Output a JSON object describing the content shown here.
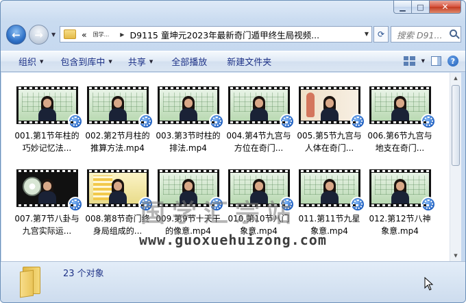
{
  "window": {
    "address_breadcrumbs": [
      "«",
      "国学...",
      "D9115 童坤元2023年最新奇门遁甲终生局视频..."
    ],
    "search_placeholder": "搜索 D91..."
  },
  "toolbar": {
    "organize": "组织",
    "include_library": "包含到库中",
    "share": "共享",
    "play_all": "全部播放",
    "new_folder": "新建文件夹"
  },
  "files": [
    {
      "name": "001.第1节年柱的巧妙记忆法...",
      "thumb": "board"
    },
    {
      "name": "002.第2节月柱的推算方法.mp4",
      "thumb": "board"
    },
    {
      "name": "003.第3节时柱的排法.mp4",
      "thumb": "board"
    },
    {
      "name": "004.第4节九宫与方位在奇门...",
      "thumb": "board"
    },
    {
      "name": "005.第5节九宫与人体在奇门...",
      "thumb": "body"
    },
    {
      "name": "006.第6节九宫与地支在奇门...",
      "thumb": "board"
    },
    {
      "name": "007.第7节八卦与九宫实际运...",
      "thumb": "wheel"
    },
    {
      "name": "008.第8节奇门终身局组成的...",
      "thumb": "yellow"
    },
    {
      "name": "009.第9节十天干的像意.mp4",
      "thumb": "board"
    },
    {
      "name": "010.第10节八门象意.mp4",
      "thumb": "board"
    },
    {
      "name": "011.第11节九星象意.mp4",
      "thumb": "board"
    },
    {
      "name": "012.第12节八神象意.mp4",
      "thumb": "board"
    }
  ],
  "watermark": {
    "cn": "国学汇宗站",
    "url": "www.guoxuehuizong.com"
  },
  "status": {
    "item_count": "23 个对象"
  },
  "colors": {
    "toolbar_text": "#1e3287",
    "badge_blue": "#1f5fc0"
  }
}
